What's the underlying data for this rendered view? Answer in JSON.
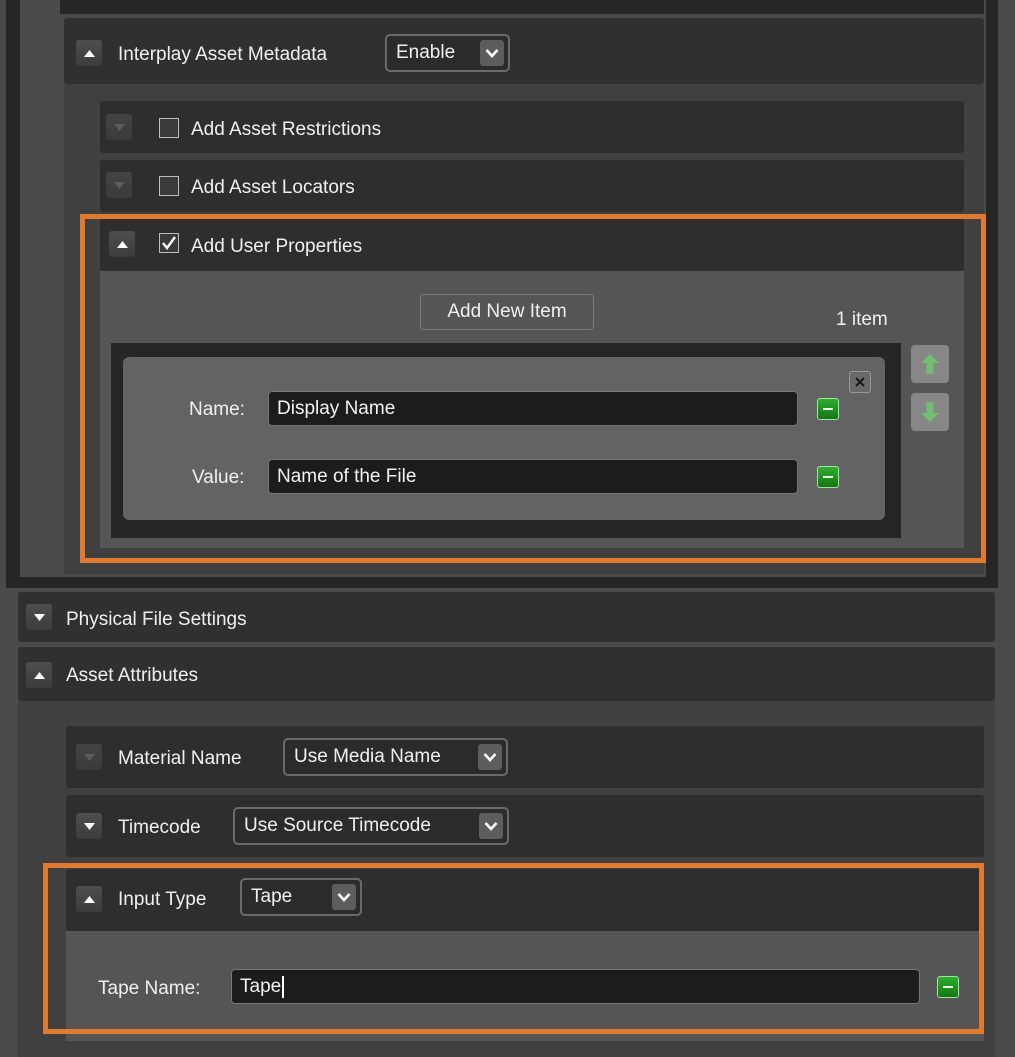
{
  "interplay_metadata": {
    "label": "Interplay Asset Metadata",
    "mode": "Enable",
    "restrictions_label": "Add Asset Restrictions",
    "restrictions_checked": false,
    "locators_label": "Add Asset Locators",
    "locators_checked": false,
    "user_props_label": "Add User Properties",
    "user_props_checked": true,
    "add_new_item_label": "Add New Item",
    "item_count": "1 item",
    "item": {
      "name_label": "Name:",
      "name_value": "Display Name",
      "value_label": "Value:",
      "value_value": "Name of the File"
    }
  },
  "physical_file_settings": {
    "label": "Physical File Settings"
  },
  "asset_attributes": {
    "label": "Asset Attributes",
    "material_name_label": "Material Name",
    "material_name_value": "Use Media Name",
    "timecode_label": "Timecode",
    "timecode_value": "Use Source Timecode",
    "input_type_label": "Input Type",
    "input_type_value": "Tape",
    "tape_name_label": "Tape Name:",
    "tape_name_value": "Tape"
  },
  "colors": {
    "highlight": "#e07a2e",
    "accent_green": "#1f8f1f",
    "panel_dark": "#262626"
  },
  "icons": {
    "expand": "triangle-up-icon",
    "collapse": "triangle-down-icon",
    "dropdown": "chevron-down-icon",
    "remove": "minus-icon",
    "close": "close-icon",
    "move_up": "arrow-up-icon",
    "move_down": "arrow-down-icon"
  }
}
